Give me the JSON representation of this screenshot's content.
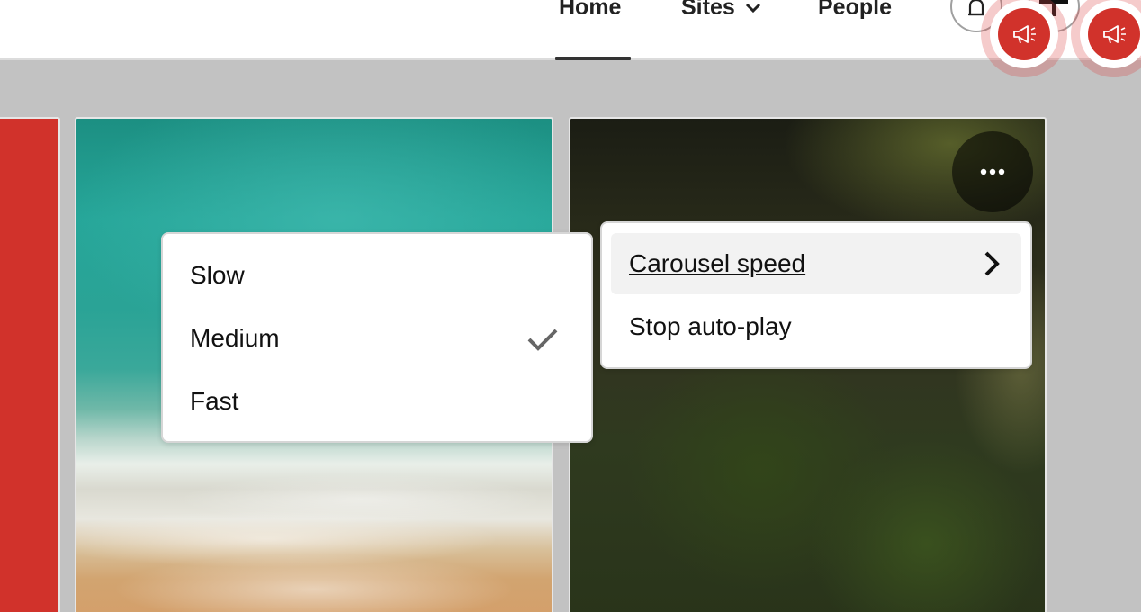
{
  "nav": {
    "items": [
      {
        "label": "Home"
      },
      {
        "label": "Sites"
      },
      {
        "label": "People"
      }
    ],
    "icons": [
      "bell-icon",
      "plus-icon",
      "megaphone-icon",
      "chevron-down-icon"
    ]
  },
  "carousel": {
    "more_icon": "more-horizontal-icon"
  },
  "speed_menu": {
    "options": [
      {
        "label": "Slow",
        "selected": false
      },
      {
        "label": "Medium",
        "selected": true
      },
      {
        "label": "Fast",
        "selected": false
      }
    ]
  },
  "options_menu": {
    "items": [
      {
        "label": "Carousel speed",
        "has_submenu": true,
        "active": true
      },
      {
        "label": "Stop auto-play",
        "has_submenu": false,
        "active": false
      }
    ]
  },
  "colors": {
    "accent_red": "#d1322b",
    "active_item_bg": "#f2f2f2",
    "page_bg": "#c2c2c2"
  }
}
